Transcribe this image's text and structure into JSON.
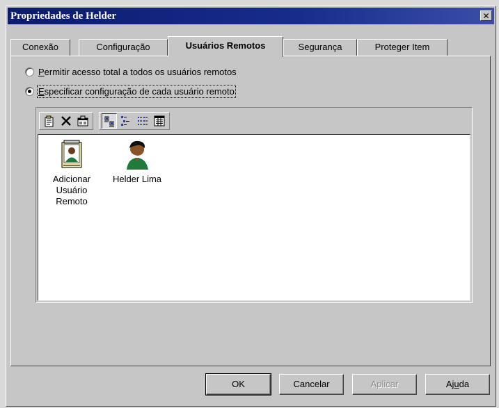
{
  "window": {
    "title": "Propriedades de Helder",
    "close_glyph": "✕"
  },
  "tabs": [
    {
      "label": "Conexão",
      "active": false
    },
    {
      "label": "Configuração",
      "active": false
    },
    {
      "label": "Usuários Remotos",
      "active": true
    },
    {
      "label": "Segurança",
      "active": false
    },
    {
      "label": "Proteger Item",
      "active": false
    }
  ],
  "options": {
    "full_access": {
      "mnemonic": "P",
      "rest": "ermitir acesso total a todos os usuários remotos",
      "checked": false
    },
    "per_user": {
      "mnemonic": "E",
      "rest": "specificar configuração de cada usuário remoto",
      "checked": true
    }
  },
  "toolbar": {
    "icons": [
      "new-icon",
      "delete-icon",
      "properties-icon",
      "large-icons-view-icon",
      "small-icons-view-icon",
      "list-view-icon",
      "details-view-icon"
    ]
  },
  "list": {
    "items": [
      {
        "label": "Adicionar Usuário Remoto",
        "icon": "add-remote-user-icon"
      },
      {
        "label": "Helder Lima",
        "icon": "user-icon"
      }
    ]
  },
  "buttons": {
    "ok": "OK",
    "cancel": "Cancelar",
    "apply": "Aplicar",
    "help_mnemonic": "u",
    "help_pre": "Aj",
    "help_post": "da"
  },
  "colors": {
    "titlebar": "#182c8c",
    "face": "#c6c6c6"
  }
}
